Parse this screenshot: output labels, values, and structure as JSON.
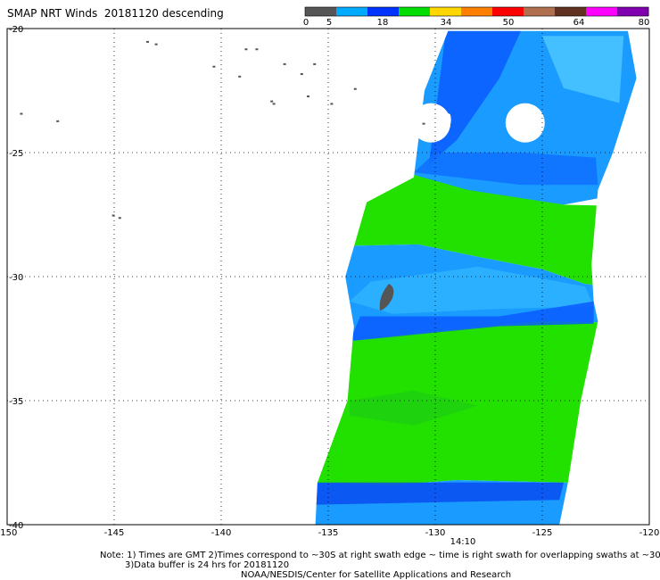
{
  "title": "SMAP NRT Winds  20181120 descending",
  "colorbar": {
    "labels": [
      "0",
      "5",
      "18",
      "34",
      "50",
      "64",
      "80"
    ],
    "colors": [
      "#555555",
      "#00aaff",
      "#0033ff",
      "#00dd00",
      "#ffd700",
      "#ff8000",
      "#ff0000",
      "#b07050",
      "#603020",
      "#ff00ff",
      "#8000b0"
    ]
  },
  "axes": {
    "x_ticks": [
      "-150",
      "-145",
      "-140",
      "-135",
      "-130",
      "-125",
      "-120"
    ],
    "y_ticks": [
      "-20",
      "-25",
      "-30",
      "-35",
      "-40"
    ],
    "xlim": [
      -150,
      -120
    ],
    "ylim": [
      -40,
      -20
    ]
  },
  "swath_time": "14:10",
  "notes": {
    "line1": "Note: 1) Times are GMT 2)Times correspond to ~30S at right swath edge ~ time is right swath for overlapping swaths at ~30S",
    "line2": "3)Data buffer is 24 hrs for 20181120",
    "line3": "NOAA/NESDIS/Center for Satellite Applications and Research"
  },
  "chart_data": {
    "type": "heatmap",
    "title": "SMAP NRT Winds  20181120 descending",
    "x_ticks": [
      -150,
      -145,
      -140,
      -135,
      -130,
      -125,
      -120
    ],
    "y_ticks": [
      -20,
      -25,
      -30,
      -35,
      -40
    ],
    "xlim": [
      -150,
      -120
    ],
    "ylim": [
      -40,
      -20
    ],
    "grid": true,
    "colorbar_ticks": [
      0,
      5,
      18,
      34,
      50,
      64,
      80
    ],
    "swath_time": "14:10",
    "wind_bands": [
      {
        "lat_from": -20.1,
        "lat_to": -26.5,
        "speed_knots": 12,
        "color": "#1a9bff"
      },
      {
        "lat_from": -26.5,
        "lat_to": -28.8,
        "speed_knots": 20,
        "color": "#22e000"
      },
      {
        "lat_from": -28.8,
        "lat_to": -32.5,
        "speed_knots": 12,
        "color": "#1a9bff"
      },
      {
        "lat_from": -32.5,
        "lat_to": -38.3,
        "speed_knots": 22,
        "color": "#22e000"
      },
      {
        "lat_from": -38.3,
        "lat_to": -40.0,
        "speed_knots": 12,
        "color": "#1a9bff"
      }
    ]
  }
}
